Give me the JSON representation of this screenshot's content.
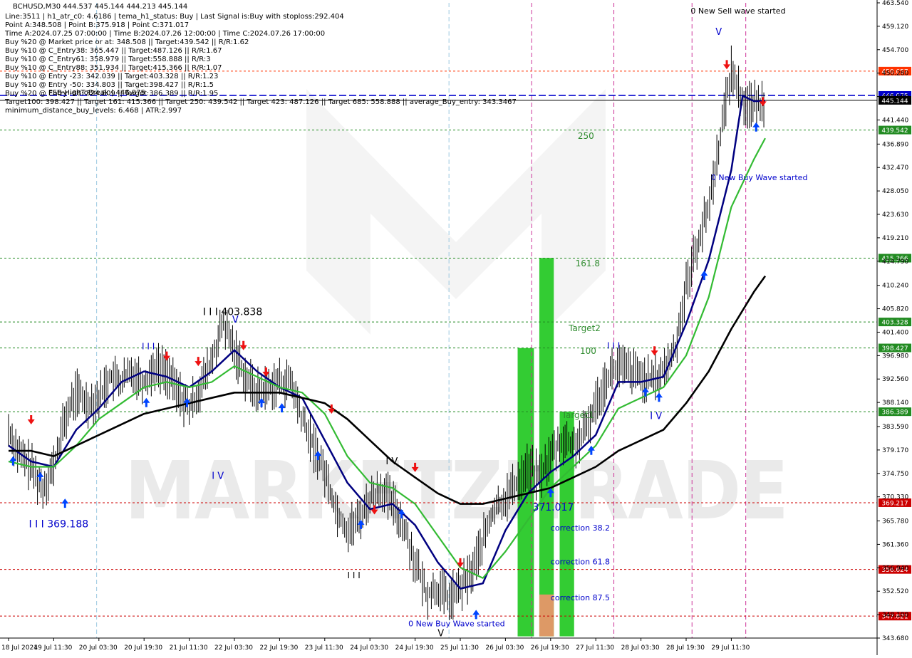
{
  "info": {
    "title": "BCHUSD,M30  444.537 445.144 444.213 445.144",
    "lines": [
      "Line:3511 | h1_atr_c0: 4.6186 | tema_h1_status: Buy | Last Signal is:Buy with stoploss:292.404",
      "Point A:348.508 | Point B:375.918 | Point C:371.017",
      "Time A:2024.07.25 07:00:00 | Time B:2024.07.26 12:00:00 | Time C:2024.07.26 17:00:00",
      "Buy %20 @ Market price or at: 348.508 || Target:439.542 || R/R:1.62",
      "Buy %10 @ C_Entry38: 365.447 || Target:487.126 || R/R:1.67",
      "Buy %10 @ C_Entry61: 358.979 || Target:558.888 || R/R:3",
      "Buy %10 @ C_Entry88: 351.934 || Target:415.366 || R/R:1.07",
      "Buy %10 @ Entry -23: 342.039 || Target:403.328 || R/R:1.23",
      "Buy %10 @ Entry -50: 334.803 || Target:398.427 || R/R:1.5",
      "Buy %20 @ Entry -88: 324.809 || Target:386.389 || R/R:1.95",
      "Target100: 398.427 || Target 161: 415.366 || Target 250: 439.542 || Target 423: 487.126 || Target 685: 558.888 || average_Buy_entry: 343.3467",
      "minimum_distance_buy_levels: 6.468 | ATR:2.997"
    ],
    "overlay_label": "FSB-HighToBreak | 446.075"
  },
  "watermark": "MARKETZITRADE",
  "chart_data": {
    "type": "line",
    "symbol": "BCHUSD",
    "timeframe": "M30",
    "ylim": [
      343.68,
      463.54
    ],
    "y_ticks": [
      {
        "v": 463.54,
        "label": "463.540"
      },
      {
        "v": 459.12,
        "label": "459.120"
      },
      {
        "v": 454.7,
        "label": "454.700"
      },
      {
        "v": 450.28,
        "label": "450.280"
      },
      {
        "v": 445.86,
        "label": "445.860"
      },
      {
        "v": 441.44,
        "label": "441.440"
      },
      {
        "v": 436.89,
        "label": "436.890"
      },
      {
        "v": 432.47,
        "label": "432.470"
      },
      {
        "v": 428.05,
        "label": "428.050"
      },
      {
        "v": 423.63,
        "label": "423.630"
      },
      {
        "v": 419.21,
        "label": "419.210"
      },
      {
        "v": 414.79,
        "label": "414.790"
      },
      {
        "v": 410.24,
        "label": "410.240"
      },
      {
        "v": 405.82,
        "label": "405.820"
      },
      {
        "v": 401.4,
        "label": "401.400"
      },
      {
        "v": 396.98,
        "label": "396.980"
      },
      {
        "v": 392.56,
        "label": "392.560"
      },
      {
        "v": 388.14,
        "label": "388.140"
      },
      {
        "v": 383.59,
        "label": "383.590"
      },
      {
        "v": 379.17,
        "label": "379.170"
      },
      {
        "v": 374.75,
        "label": "374.750"
      },
      {
        "v": 370.33,
        "label": "370.330"
      },
      {
        "v": 365.78,
        "label": "365.780"
      },
      {
        "v": 361.36,
        "label": "361.360"
      },
      {
        "v": 356.94,
        "label": "356.940"
      },
      {
        "v": 352.52,
        "label": "352.520"
      },
      {
        "v": 348.1,
        "label": "348.100"
      },
      {
        "v": 343.68,
        "label": "343.680"
      }
    ],
    "x_ticks": [
      {
        "i": 0,
        "label": "18 Jul 2024"
      },
      {
        "i": 1,
        "label": "19 Jul 11:30"
      },
      {
        "i": 2,
        "label": "20 Jul 03:30"
      },
      {
        "i": 3,
        "label": "20 Jul 19:30"
      },
      {
        "i": 4,
        "label": "21 Jul 11:30"
      },
      {
        "i": 5,
        "label": "22 Jul 03:30"
      },
      {
        "i": 6,
        "label": "22 Jul 19:30"
      },
      {
        "i": 7,
        "label": "23 Jul 11:30"
      },
      {
        "i": 8,
        "label": "24 Jul 03:30"
      },
      {
        "i": 9,
        "label": "24 Jul 19:30"
      },
      {
        "i": 10,
        "label": "25 Jul 11:30"
      },
      {
        "i": 11,
        "label": "26 Jul 03:30"
      },
      {
        "i": 12,
        "label": "26 Jul 19:30"
      },
      {
        "i": 13,
        "label": "27 Jul 11:30"
      },
      {
        "i": 14,
        "label": "28 Jul 03:30"
      },
      {
        "i": 15,
        "label": "28 Jul 19:30"
      },
      {
        "i": 16,
        "label": "29 Jul 11:30"
      }
    ],
    "levels": [
      {
        "price": 450.657,
        "label": "450.657",
        "color": "#ff3300",
        "bg": "#ff3300"
      },
      {
        "price": 446.075,
        "label": "446.075",
        "color": "#0000cc",
        "bg": "#0000cc"
      },
      {
        "price": 445.144,
        "label": "445.144",
        "color": "#000000",
        "bg": "#000000"
      },
      {
        "price": 439.542,
        "label": "439.542",
        "color": "#228b22",
        "bg": "#228b22"
      },
      {
        "price": 415.366,
        "label": "415.366",
        "color": "#228b22",
        "bg": "#228b22"
      },
      {
        "price": 403.328,
        "label": "403.328",
        "color": "#228b22",
        "bg": "#228b22"
      },
      {
        "price": 398.427,
        "label": "398.427",
        "color": "#228b22",
        "bg": "#228b22"
      },
      {
        "price": 386.389,
        "label": "386.389",
        "color": "#228b22",
        "bg": "#228b22"
      },
      {
        "price": 369.217,
        "label": "369.217",
        "color": "#cc0000",
        "bg": "#cc0000"
      },
      {
        "price": 356.624,
        "label": "356.624",
        "color": "#cc0000",
        "bg": "#cc0000"
      },
      {
        "price": 347.821,
        "label": "347.821",
        "color": "#cc0000",
        "bg": "#cc0000"
      }
    ],
    "series": [
      {
        "name": "Close",
        "color": "#000000",
        "x": [
          0,
          0.25,
          0.5,
          0.75,
          1,
          1.25,
          1.5,
          1.75,
          2,
          2.25,
          2.5,
          2.75,
          3,
          3.25,
          3.5,
          3.75,
          4,
          4.25,
          4.5,
          4.75,
          5,
          5.25,
          5.5,
          5.75,
          6,
          6.25,
          6.5,
          6.75,
          7,
          7.25,
          7.5,
          7.75,
          8,
          8.25,
          8.5,
          8.75,
          9,
          9.25,
          9.5,
          9.75,
          10,
          10.25,
          10.5,
          10.75,
          11,
          11.25,
          11.5,
          11.75,
          12,
          12.25,
          12.5,
          12.75,
          13,
          13.25,
          13.5,
          13.75,
          14,
          14.25,
          14.5,
          14.75,
          15,
          15.25,
          15.5,
          15.75,
          16,
          16.25,
          16.5,
          16.75
        ],
        "values": [
          383,
          378,
          376,
          372,
          376,
          385,
          390,
          388,
          389,
          393,
          392,
          394,
          392,
          395,
          394,
          390,
          387,
          391,
          396,
          403,
          398,
          393,
          390,
          391,
          392,
          392,
          385,
          380,
          375,
          368,
          364,
          366,
          370,
          372,
          369,
          365,
          358,
          352,
          353,
          351,
          353,
          356,
          362,
          368,
          370,
          373,
          376,
          374,
          378,
          381,
          380,
          382,
          388,
          393,
          395,
          394,
          393,
          392,
          394,
          398,
          410,
          418,
          425,
          438,
          451,
          445,
          444,
          445
        ]
      },
      {
        "name": "Fast MA",
        "color": "#000080",
        "x": [
          0,
          0.5,
          1,
          1.5,
          2,
          2.5,
          3,
          3.5,
          4,
          4.5,
          5,
          5.5,
          6,
          6.5,
          7,
          7.5,
          8,
          8.5,
          9,
          9.5,
          10,
          10.5,
          11,
          11.5,
          12,
          12.5,
          13,
          13.5,
          14,
          14.5,
          15,
          15.5,
          16,
          16.25,
          16.5,
          16.75
        ],
        "values": [
          380,
          377,
          376,
          383,
          387,
          392,
          394,
          393,
          391,
          394,
          398,
          394,
          391,
          389,
          381,
          373,
          368,
          369,
          365,
          358,
          353,
          354,
          364,
          371,
          375,
          378,
          382,
          392,
          392,
          393,
          403,
          415,
          432,
          446,
          445,
          445
        ]
      },
      {
        "name": "Slow MA",
        "color": "#33bb33",
        "x": [
          0,
          0.5,
          1,
          1.5,
          2,
          2.5,
          3,
          3.5,
          4,
          4.5,
          5,
          5.5,
          6,
          6.5,
          7,
          7.5,
          8,
          8.5,
          9,
          9.5,
          10,
          10.5,
          11,
          11.5,
          12,
          12.5,
          13,
          13.5,
          14,
          14.5,
          15,
          15.5,
          16,
          16.5,
          16.75
        ],
        "values": [
          377,
          376,
          376,
          380,
          385,
          388,
          391,
          392,
          391,
          392,
          395,
          393,
          391,
          390,
          386,
          378,
          373,
          372,
          369,
          363,
          357,
          355,
          360,
          366,
          372,
          376,
          380,
          387,
          389,
          391,
          397,
          408,
          425,
          434,
          438
        ]
      },
      {
        "name": "Long MA",
        "color": "#000000",
        "x": [
          0,
          0.5,
          1,
          1.5,
          2,
          2.5,
          3,
          3.5,
          4,
          4.5,
          5,
          5.5,
          6,
          6.5,
          7,
          7.5,
          8,
          8.5,
          9,
          9.5,
          10,
          10.5,
          11,
          11.5,
          12,
          12.5,
          13,
          13.5,
          14,
          14.5,
          15,
          15.5,
          16,
          16.5,
          16.75
        ],
        "values": [
          379,
          379,
          378,
          380,
          382,
          384,
          386,
          387,
          388,
          389,
          390,
          390,
          390,
          389,
          388,
          385,
          381,
          377,
          374,
          371,
          369,
          369,
          370,
          371,
          372,
          374,
          376,
          379,
          381,
          383,
          388,
          394,
          402,
          409,
          412
        ]
      }
    ],
    "annotations": [
      {
        "text": "0 New Sell wave started",
        "x": 15.1,
        "y": 461.5,
        "cls": "ann-black",
        "size": 11
      },
      {
        "text": "V",
        "x": 15.65,
        "y": 457.5,
        "cls": "ann-blue",
        "size": 13
      },
      {
        "text": "250",
        "x": 12.6,
        "y": 437.9,
        "cls": "ann-green",
        "size": 12
      },
      {
        "text": "0 New Buy Wave started",
        "x": 15.55,
        "y": 430.1,
        "cls": "ann-blue",
        "size": 11
      },
      {
        "text": "161.8",
        "x": 12.55,
        "y": 413.8,
        "cls": "ann-green",
        "size": 12
      },
      {
        "text": "I I I 403.838",
        "x": 4.3,
        "y": 404.6,
        "cls": "ann-black",
        "size": 14
      },
      {
        "text": "V",
        "x": 4.95,
        "y": 403.2,
        "cls": "ann-blue",
        "size": 13
      },
      {
        "text": "Target2",
        "x": 12.4,
        "y": 401.6,
        "cls": "ann-green",
        "size": 12
      },
      {
        "text": "I I I",
        "x": 2.95,
        "y": 398.2,
        "cls": "ann-blue",
        "size": 12
      },
      {
        "text": "I I I",
        "x": 13.25,
        "y": 398.3,
        "cls": "ann-blue",
        "size": 12
      },
      {
        "text": "100",
        "x": 12.65,
        "y": 397.3,
        "cls": "ann-green",
        "size": 12
      },
      {
        "text": "Target1",
        "x": 12.25,
        "y": 385.2,
        "cls": "ann-green",
        "size": 12
      },
      {
        "text": "I V",
        "x": 14.2,
        "y": 385.0,
        "cls": "ann-blue",
        "size": 13
      },
      {
        "text": "I V",
        "x": 8.35,
        "y": 376.5,
        "cls": "ann-black",
        "size": 13
      },
      {
        "text": "I V",
        "x": 4.5,
        "y": 373.7,
        "cls": "ann-blue",
        "size": 13
      },
      {
        "text": "371.017",
        "x": 11.6,
        "y": 367.7,
        "cls": "ann-blue",
        "size": 14
      },
      {
        "text": "I I I 369.188",
        "x": 0.45,
        "y": 364.6,
        "cls": "ann-blue",
        "size": 14
      },
      {
        "text": "correction 38.2",
        "x": 12.0,
        "y": 364.0,
        "cls": "ann-blue",
        "size": 11
      },
      {
        "text": "correction 61.8",
        "x": 12.0,
        "y": 357.6,
        "cls": "ann-blue",
        "size": 11
      },
      {
        "text": "I I I",
        "x": 7.5,
        "y": 355.0,
        "cls": "ann-black",
        "size": 12
      },
      {
        "text": "correction 87.5",
        "x": 12.0,
        "y": 350.8,
        "cls": "ann-blue",
        "size": 11
      },
      {
        "text": "0 New Buy Wave started",
        "x": 8.85,
        "y": 345.9,
        "cls": "ann-blue",
        "size": 11
      },
      {
        "text": "V",
        "x": 9.5,
        "y": 344.0,
        "cls": "ann-black",
        "size": 13
      }
    ]
  }
}
